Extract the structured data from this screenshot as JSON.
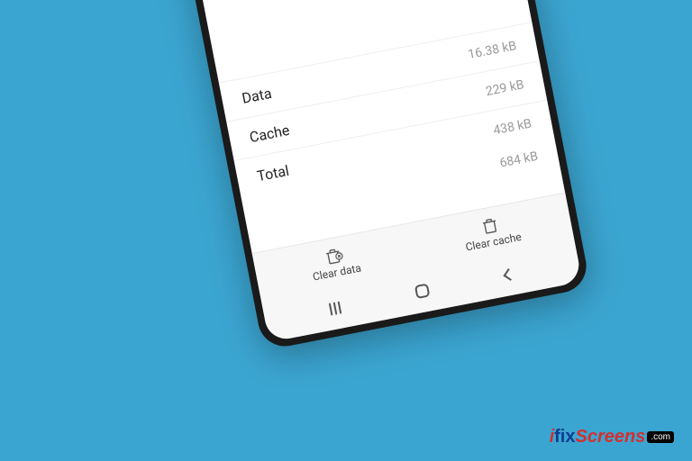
{
  "storage": {
    "rows": [
      {
        "label": "Data",
        "value": "16.38 kB"
      },
      {
        "label": "Cache",
        "value": "229 kB"
      },
      {
        "label": "Total",
        "value": "438 kB"
      }
    ],
    "extra_value": "684 kB"
  },
  "actions": {
    "clear_data": "Clear data",
    "clear_cache": "Clear cache"
  },
  "watermark": {
    "prefix": "i",
    "mid": "fix",
    "suffix": "Screens",
    "tld": ".com"
  }
}
